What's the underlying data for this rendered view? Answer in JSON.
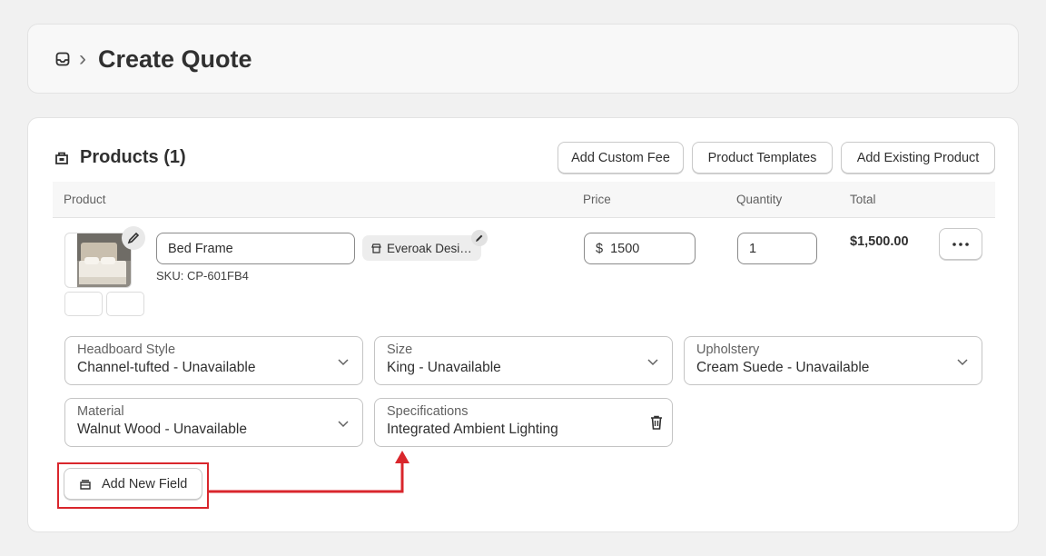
{
  "header": {
    "title": "Create Quote",
    "separator": "›",
    "icon": "inbox-icon"
  },
  "products": {
    "title": "Products (1)",
    "buttons": {
      "custom_fee": "Add Custom Fee",
      "templates": "Product Templates",
      "existing": "Add Existing Product"
    },
    "columns": {
      "product": "Product",
      "price": "Price",
      "quantity": "Quantity",
      "total": "Total"
    },
    "item": {
      "name": "Bed Frame",
      "sku": "SKU: CP-601FB4",
      "vendor": "Everoak Designs",
      "currency_symbol": "$",
      "price": "1500",
      "quantity": "1",
      "total": "$1,500.00"
    },
    "fields": [
      {
        "label": "Headboard Style",
        "value": "Channel-tufted - Unavailable"
      },
      {
        "label": "Size",
        "value": "King - Unavailable"
      },
      {
        "label": "Upholstery",
        "value": "Cream Suede - Unavailable"
      },
      {
        "label": "Material",
        "value": "Walnut Wood - Unavailable"
      },
      {
        "label": "Specifications",
        "value": "Integrated Ambient Lighting"
      }
    ],
    "add_field_label": "Add New Field"
  },
  "colors": {
    "accent_red": "#d9262c",
    "text": "#303030",
    "muted": "#616161"
  }
}
